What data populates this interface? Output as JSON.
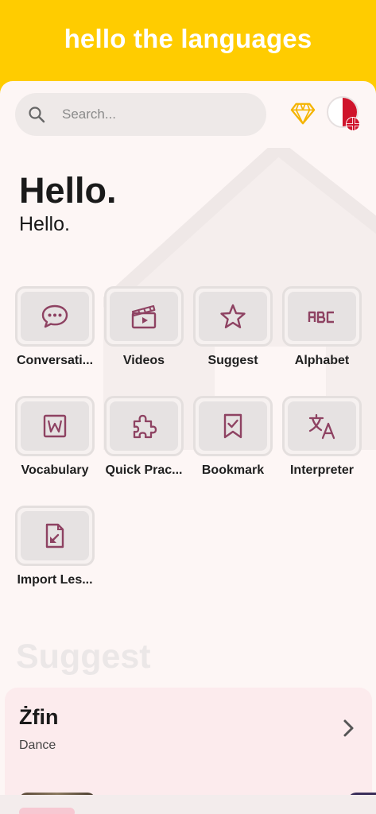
{
  "app": {
    "title": "hello the languages"
  },
  "search": {
    "placeholder": "Search..."
  },
  "greeting": {
    "title": "Hello.",
    "subtitle": "Hello."
  },
  "menu": [
    {
      "label": "Conversati...",
      "icon": "chat-bubble-icon"
    },
    {
      "label": "Videos",
      "icon": "clapperboard-icon"
    },
    {
      "label": "Suggest",
      "icon": "star-icon"
    },
    {
      "label": "Alphabet",
      "icon": "abc-icon"
    },
    {
      "label": "Vocabulary",
      "icon": "word-document-icon"
    },
    {
      "label": "Quick Prac...",
      "icon": "puzzle-piece-icon"
    },
    {
      "label": "Bookmark",
      "icon": "bookmark-check-icon"
    },
    {
      "label": "Interpreter",
      "icon": "translate-icon"
    },
    {
      "label": "Import Les...",
      "icon": "file-import-icon"
    }
  ],
  "suggest": {
    "heading": "Suggest",
    "card": {
      "word": "Żfin",
      "meaning": "Dance"
    }
  },
  "colors": {
    "header": "#FFCC00",
    "icon_accent": "#8E4262",
    "diamond": "#F4B400",
    "card_bg": "#FDF6F5",
    "suggest_card_bg": "#FCEBED"
  }
}
